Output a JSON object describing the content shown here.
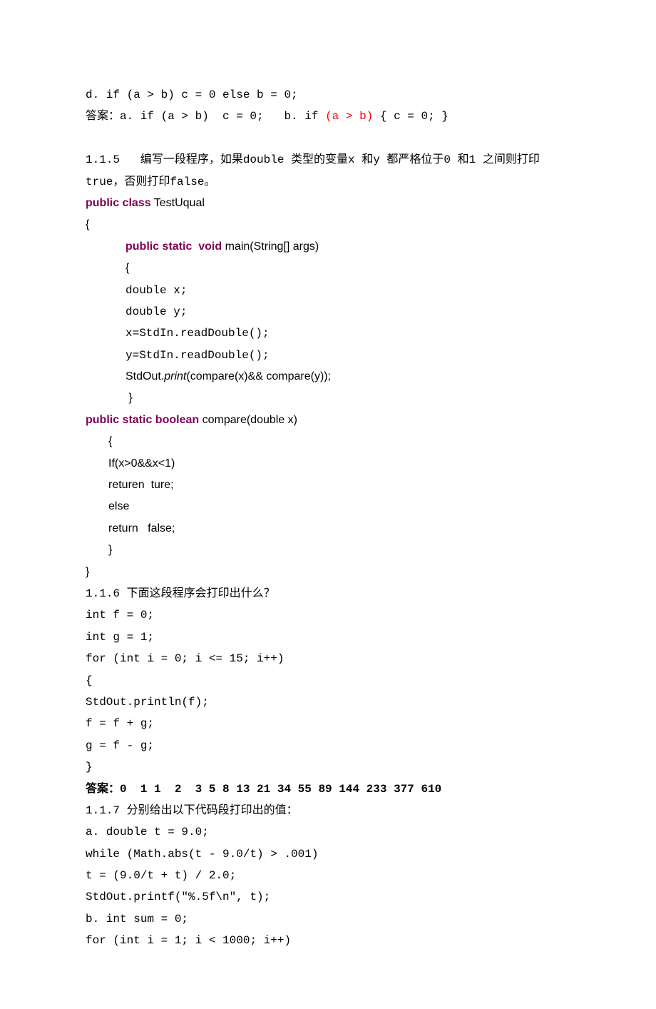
{
  "lines": [
    {
      "cls": "mono line",
      "segs": [
        {
          "t": "d. if (a > b) c = 0 else b = 0;"
        }
      ]
    },
    {
      "cls": "mono line",
      "segs": [
        {
          "t": "答案：a. if (a > b)  c = 0;   b. if "
        },
        {
          "t": "(a > b)",
          "c": "red"
        },
        {
          "t": " { c = 0; }"
        }
      ]
    },
    {
      "cls": "line",
      "segs": [
        {
          "t": " "
        }
      ]
    },
    {
      "cls": "mono line",
      "segs": [
        {
          "t": "1.1.5   编写一段程序，如果double 类型的变量x 和y 都严格位于0 和1 之间则打印true，否则打印false。"
        }
      ]
    },
    {
      "cls": "sans line",
      "segs": [
        {
          "t": "public class",
          "c": "purple"
        },
        {
          "t": " TestUqual"
        }
      ]
    },
    {
      "cls": "sans line",
      "segs": [
        {
          "t": "{"
        }
      ]
    },
    {
      "cls": "sans line indent1",
      "segs": [
        {
          "t": "public static  void",
          "c": "purple"
        },
        {
          "t": " main(String[] args)"
        }
      ]
    },
    {
      "cls": "sans line indent1",
      "segs": [
        {
          "t": "{"
        }
      ]
    },
    {
      "cls": "mono line indent1",
      "segs": [
        {
          "t": "double x;"
        }
      ]
    },
    {
      "cls": "mono line indent1",
      "segs": [
        {
          "t": "double y;"
        }
      ]
    },
    {
      "cls": "mono line indent1",
      "segs": [
        {
          "t": "x=StdIn.readDouble();"
        }
      ]
    },
    {
      "cls": "mono line indent1",
      "segs": [
        {
          "t": "y=StdIn.readDouble();"
        }
      ]
    },
    {
      "cls": "sans line indent1",
      "segs": [
        {
          "t": "StdOut."
        },
        {
          "t": "print",
          "i": true
        },
        {
          "t": "(compare(x)&& compare(y));"
        }
      ]
    },
    {
      "cls": "sans line indent1",
      "segs": [
        {
          "t": " }"
        }
      ]
    },
    {
      "cls": "sans line",
      "segs": [
        {
          "t": "public static boolean",
          "c": "purple"
        },
        {
          "t": " compare(double x)"
        }
      ]
    },
    {
      "cls": "sans line indent2",
      "segs": [
        {
          "t": "{"
        }
      ]
    },
    {
      "cls": "sans line indent2",
      "segs": [
        {
          "t": "If(x>0&&x<1)"
        }
      ]
    },
    {
      "cls": "sans line indent2",
      "segs": [
        {
          "t": "returen  ture;"
        }
      ]
    },
    {
      "cls": "sans line indent2",
      "segs": [
        {
          "t": "else"
        }
      ]
    },
    {
      "cls": "sans line indent2",
      "segs": [
        {
          "t": "return   false;"
        }
      ]
    },
    {
      "cls": "sans line indent2",
      "segs": [
        {
          "t": "}"
        }
      ]
    },
    {
      "cls": "sans line",
      "segs": [
        {
          "t": "}"
        }
      ]
    },
    {
      "cls": "mono line",
      "segs": [
        {
          "t": "1.1.6 下面这段程序会打印出什么？"
        }
      ]
    },
    {
      "cls": "mono line",
      "segs": [
        {
          "t": "int f = 0;"
        }
      ]
    },
    {
      "cls": "mono line",
      "segs": [
        {
          "t": "int g = 1;"
        }
      ]
    },
    {
      "cls": "mono line",
      "segs": [
        {
          "t": "for (int i = 0; i <= 15; i++)"
        }
      ]
    },
    {
      "cls": "mono line",
      "segs": [
        {
          "t": "{"
        }
      ]
    },
    {
      "cls": "mono line",
      "segs": [
        {
          "t": "StdOut.println(f);"
        }
      ]
    },
    {
      "cls": "mono line",
      "segs": [
        {
          "t": "f = f + g;"
        }
      ]
    },
    {
      "cls": "mono line",
      "segs": [
        {
          "t": "g = f - g;"
        }
      ]
    },
    {
      "cls": "mono line",
      "segs": [
        {
          "t": "}"
        }
      ]
    },
    {
      "cls": "mono line bold",
      "segs": [
        {
          "t": "答案：0  1 1  2  3 5 8 13 21 34 55 89 144 233 377 610"
        }
      ]
    },
    {
      "cls": "mono line",
      "segs": [
        {
          "t": "1.1.7 分别给出以下代码段打印出的值："
        }
      ]
    },
    {
      "cls": "mono line",
      "segs": [
        {
          "t": "a. double t = 9.0;"
        }
      ]
    },
    {
      "cls": "mono line",
      "segs": [
        {
          "t": "while (Math.abs(t - 9.0/t) > .001)"
        }
      ]
    },
    {
      "cls": "mono line",
      "segs": [
        {
          "t": "t = (9.0/t + t) / 2.0;"
        }
      ]
    },
    {
      "cls": "mono line",
      "segs": [
        {
          "t": "StdOut.printf(\"%.5f\\n\", t);"
        }
      ]
    },
    {
      "cls": "mono line",
      "segs": [
        {
          "t": "b. int sum = 0;"
        }
      ]
    },
    {
      "cls": "mono line",
      "segs": [
        {
          "t": "for (int i = 1; i < 1000; i++)"
        }
      ]
    }
  ]
}
